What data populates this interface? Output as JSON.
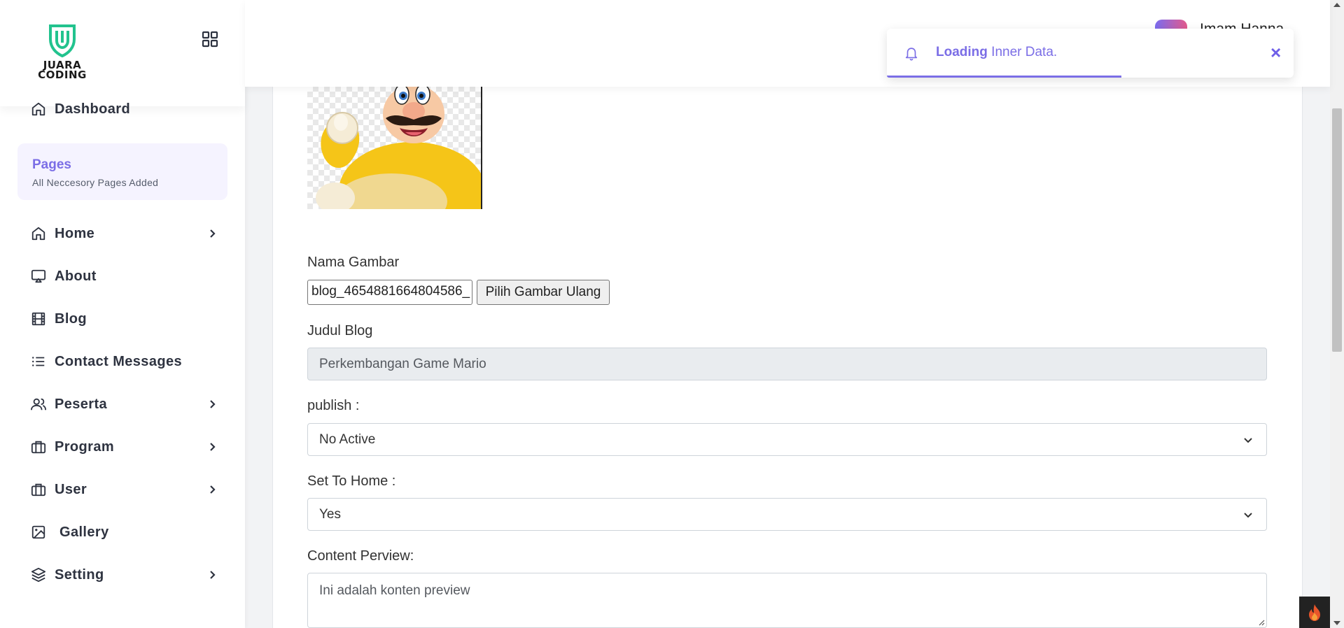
{
  "brand": {
    "logo_text_line1": "JUARA",
    "logo_text_line2": "CODING",
    "accent_color": "#7b6ee6"
  },
  "sidebar": {
    "dashboard_label": "Dashboard",
    "pages_card": {
      "title": "Pages",
      "subtitle": "All Neccesory Pages Added"
    },
    "items": [
      {
        "label": "Home",
        "icon": "home-icon",
        "has_submenu": true
      },
      {
        "label": "About",
        "icon": "cast-icon",
        "has_submenu": false
      },
      {
        "label": "Blog",
        "icon": "film-icon",
        "has_submenu": false
      },
      {
        "label": "Contact Messages",
        "icon": "list-icon",
        "has_submenu": false
      },
      {
        "label": "Peserta",
        "icon": "users-icon",
        "has_submenu": true
      },
      {
        "label": "Program",
        "icon": "briefcase-icon",
        "has_submenu": true
      },
      {
        "label": "User",
        "icon": "briefcase-icon",
        "has_submenu": true
      },
      {
        "label": "Gallery",
        "icon": "image-icon",
        "has_submenu": false
      },
      {
        "label": "Setting",
        "icon": "layers-icon",
        "has_submenu": true
      }
    ]
  },
  "header": {
    "user_name": "Imam Hanna"
  },
  "toast": {
    "strong": "Loading",
    "message": "Inner Data.",
    "close": "×"
  },
  "form": {
    "image_name_label": "Nama Gambar",
    "image_file_value": "blog_4654881664804586_",
    "choose_image_button": "Pilih Gambar Ulang",
    "title_label": "Judul Blog",
    "title_value": "Perkembangan Game Mario",
    "publish_label": "publish :",
    "publish_value": "No Active",
    "set_home_label": "Set To Home :",
    "set_home_value": "Yes",
    "content_preview_label": "Content Perview:",
    "content_preview_value": "Ini adalah konten preview"
  }
}
